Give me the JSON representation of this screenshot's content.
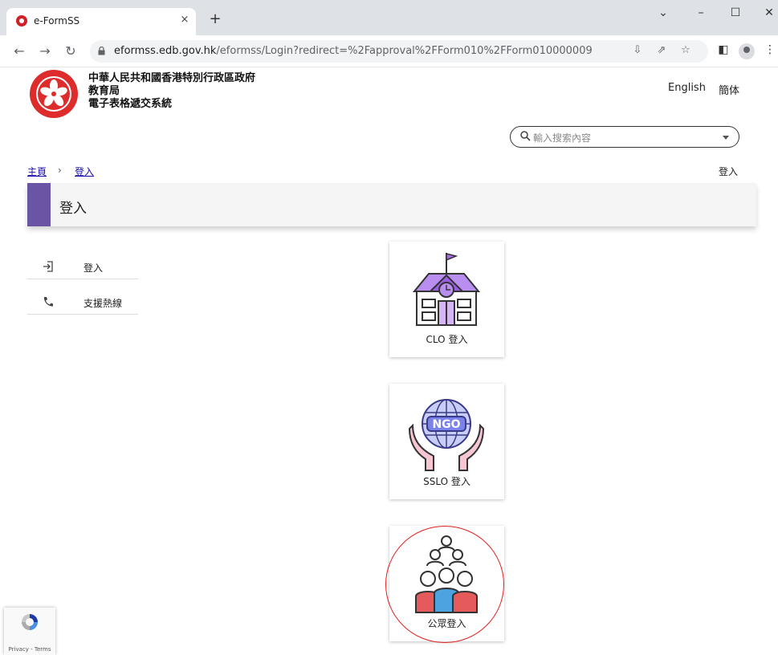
{
  "browser": {
    "tab_title": "e-FormSS",
    "tab_close": "×",
    "new_tab": "+",
    "url_domain": "eformss.edb.gov.hk",
    "url_path": "/eformss/Login?redirect=%2Fapproval%2FForm010%2FForm010000009"
  },
  "header": {
    "gov_name": "中華人民共和國香港特別行政區政府",
    "dept_name": "教育局",
    "system_name": "電子表格遞交系統",
    "lang_en": "English",
    "lang_sc": "簡体"
  },
  "search": {
    "placeholder": "輸入搜索內容"
  },
  "breadcrumb": {
    "home": "主頁",
    "separator": "›",
    "current": "登入",
    "right_label": "登入"
  },
  "page_title": "登入",
  "sidebar": {
    "items": [
      {
        "label": "登入",
        "icon": "login-icon"
      },
      {
        "label": "支援熱線",
        "icon": "phone-icon"
      }
    ]
  },
  "login_options": [
    {
      "label": "CLO 登入",
      "icon": "school-icon"
    },
    {
      "label": "SSLO 登入",
      "icon": "ngo-globe-icon",
      "badge": "NGO"
    },
    {
      "label": "公眾登入",
      "icon": "public-people-icon"
    }
  ],
  "recaptcha": {
    "text": "Privacy - Terms"
  },
  "colors": {
    "accent": "#6a55a5",
    "highlight_circle": "#e02020"
  }
}
